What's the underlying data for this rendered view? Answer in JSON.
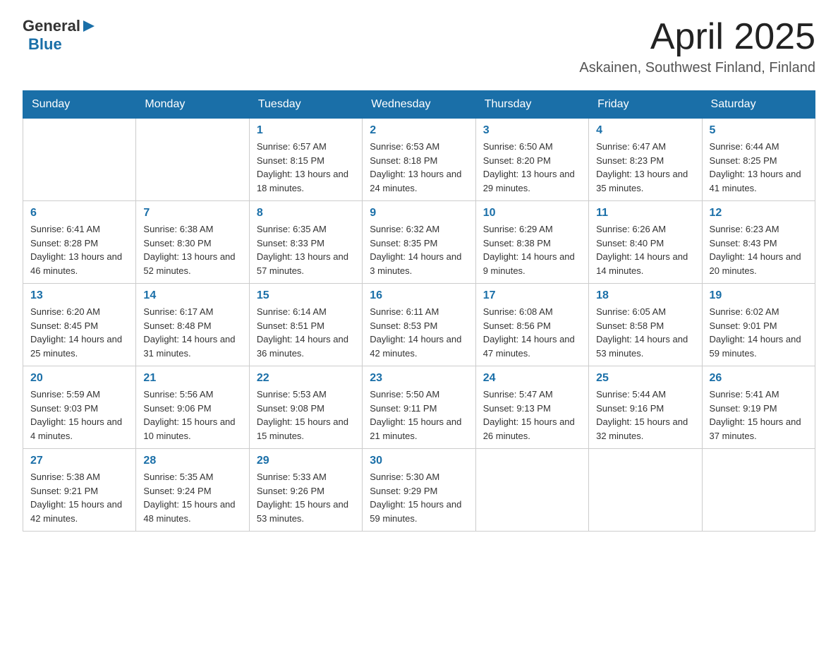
{
  "header": {
    "logo_general": "General",
    "logo_blue": "Blue",
    "title": "April 2025",
    "subtitle": "Askainen, Southwest Finland, Finland"
  },
  "weekdays": [
    "Sunday",
    "Monday",
    "Tuesday",
    "Wednesday",
    "Thursday",
    "Friday",
    "Saturday"
  ],
  "weeks": [
    [
      {
        "day": "",
        "sunrise": "",
        "sunset": "",
        "daylight": ""
      },
      {
        "day": "",
        "sunrise": "",
        "sunset": "",
        "daylight": ""
      },
      {
        "day": "1",
        "sunrise": "Sunrise: 6:57 AM",
        "sunset": "Sunset: 8:15 PM",
        "daylight": "Daylight: 13 hours and 18 minutes."
      },
      {
        "day": "2",
        "sunrise": "Sunrise: 6:53 AM",
        "sunset": "Sunset: 8:18 PM",
        "daylight": "Daylight: 13 hours and 24 minutes."
      },
      {
        "day": "3",
        "sunrise": "Sunrise: 6:50 AM",
        "sunset": "Sunset: 8:20 PM",
        "daylight": "Daylight: 13 hours and 29 minutes."
      },
      {
        "day": "4",
        "sunrise": "Sunrise: 6:47 AM",
        "sunset": "Sunset: 8:23 PM",
        "daylight": "Daylight: 13 hours and 35 minutes."
      },
      {
        "day": "5",
        "sunrise": "Sunrise: 6:44 AM",
        "sunset": "Sunset: 8:25 PM",
        "daylight": "Daylight: 13 hours and 41 minutes."
      }
    ],
    [
      {
        "day": "6",
        "sunrise": "Sunrise: 6:41 AM",
        "sunset": "Sunset: 8:28 PM",
        "daylight": "Daylight: 13 hours and 46 minutes."
      },
      {
        "day": "7",
        "sunrise": "Sunrise: 6:38 AM",
        "sunset": "Sunset: 8:30 PM",
        "daylight": "Daylight: 13 hours and 52 minutes."
      },
      {
        "day": "8",
        "sunrise": "Sunrise: 6:35 AM",
        "sunset": "Sunset: 8:33 PM",
        "daylight": "Daylight: 13 hours and 57 minutes."
      },
      {
        "day": "9",
        "sunrise": "Sunrise: 6:32 AM",
        "sunset": "Sunset: 8:35 PM",
        "daylight": "Daylight: 14 hours and 3 minutes."
      },
      {
        "day": "10",
        "sunrise": "Sunrise: 6:29 AM",
        "sunset": "Sunset: 8:38 PM",
        "daylight": "Daylight: 14 hours and 9 minutes."
      },
      {
        "day": "11",
        "sunrise": "Sunrise: 6:26 AM",
        "sunset": "Sunset: 8:40 PM",
        "daylight": "Daylight: 14 hours and 14 minutes."
      },
      {
        "day": "12",
        "sunrise": "Sunrise: 6:23 AM",
        "sunset": "Sunset: 8:43 PM",
        "daylight": "Daylight: 14 hours and 20 minutes."
      }
    ],
    [
      {
        "day": "13",
        "sunrise": "Sunrise: 6:20 AM",
        "sunset": "Sunset: 8:45 PM",
        "daylight": "Daylight: 14 hours and 25 minutes."
      },
      {
        "day": "14",
        "sunrise": "Sunrise: 6:17 AM",
        "sunset": "Sunset: 8:48 PM",
        "daylight": "Daylight: 14 hours and 31 minutes."
      },
      {
        "day": "15",
        "sunrise": "Sunrise: 6:14 AM",
        "sunset": "Sunset: 8:51 PM",
        "daylight": "Daylight: 14 hours and 36 minutes."
      },
      {
        "day": "16",
        "sunrise": "Sunrise: 6:11 AM",
        "sunset": "Sunset: 8:53 PM",
        "daylight": "Daylight: 14 hours and 42 minutes."
      },
      {
        "day": "17",
        "sunrise": "Sunrise: 6:08 AM",
        "sunset": "Sunset: 8:56 PM",
        "daylight": "Daylight: 14 hours and 47 minutes."
      },
      {
        "day": "18",
        "sunrise": "Sunrise: 6:05 AM",
        "sunset": "Sunset: 8:58 PM",
        "daylight": "Daylight: 14 hours and 53 minutes."
      },
      {
        "day": "19",
        "sunrise": "Sunrise: 6:02 AM",
        "sunset": "Sunset: 9:01 PM",
        "daylight": "Daylight: 14 hours and 59 minutes."
      }
    ],
    [
      {
        "day": "20",
        "sunrise": "Sunrise: 5:59 AM",
        "sunset": "Sunset: 9:03 PM",
        "daylight": "Daylight: 15 hours and 4 minutes."
      },
      {
        "day": "21",
        "sunrise": "Sunrise: 5:56 AM",
        "sunset": "Sunset: 9:06 PM",
        "daylight": "Daylight: 15 hours and 10 minutes."
      },
      {
        "day": "22",
        "sunrise": "Sunrise: 5:53 AM",
        "sunset": "Sunset: 9:08 PM",
        "daylight": "Daylight: 15 hours and 15 minutes."
      },
      {
        "day": "23",
        "sunrise": "Sunrise: 5:50 AM",
        "sunset": "Sunset: 9:11 PM",
        "daylight": "Daylight: 15 hours and 21 minutes."
      },
      {
        "day": "24",
        "sunrise": "Sunrise: 5:47 AM",
        "sunset": "Sunset: 9:13 PM",
        "daylight": "Daylight: 15 hours and 26 minutes."
      },
      {
        "day": "25",
        "sunrise": "Sunrise: 5:44 AM",
        "sunset": "Sunset: 9:16 PM",
        "daylight": "Daylight: 15 hours and 32 minutes."
      },
      {
        "day": "26",
        "sunrise": "Sunrise: 5:41 AM",
        "sunset": "Sunset: 9:19 PM",
        "daylight": "Daylight: 15 hours and 37 minutes."
      }
    ],
    [
      {
        "day": "27",
        "sunrise": "Sunrise: 5:38 AM",
        "sunset": "Sunset: 9:21 PM",
        "daylight": "Daylight: 15 hours and 42 minutes."
      },
      {
        "day": "28",
        "sunrise": "Sunrise: 5:35 AM",
        "sunset": "Sunset: 9:24 PM",
        "daylight": "Daylight: 15 hours and 48 minutes."
      },
      {
        "day": "29",
        "sunrise": "Sunrise: 5:33 AM",
        "sunset": "Sunset: 9:26 PM",
        "daylight": "Daylight: 15 hours and 53 minutes."
      },
      {
        "day": "30",
        "sunrise": "Sunrise: 5:30 AM",
        "sunset": "Sunset: 9:29 PM",
        "daylight": "Daylight: 15 hours and 59 minutes."
      },
      {
        "day": "",
        "sunrise": "",
        "sunset": "",
        "daylight": ""
      },
      {
        "day": "",
        "sunrise": "",
        "sunset": "",
        "daylight": ""
      },
      {
        "day": "",
        "sunrise": "",
        "sunset": "",
        "daylight": ""
      }
    ]
  ]
}
